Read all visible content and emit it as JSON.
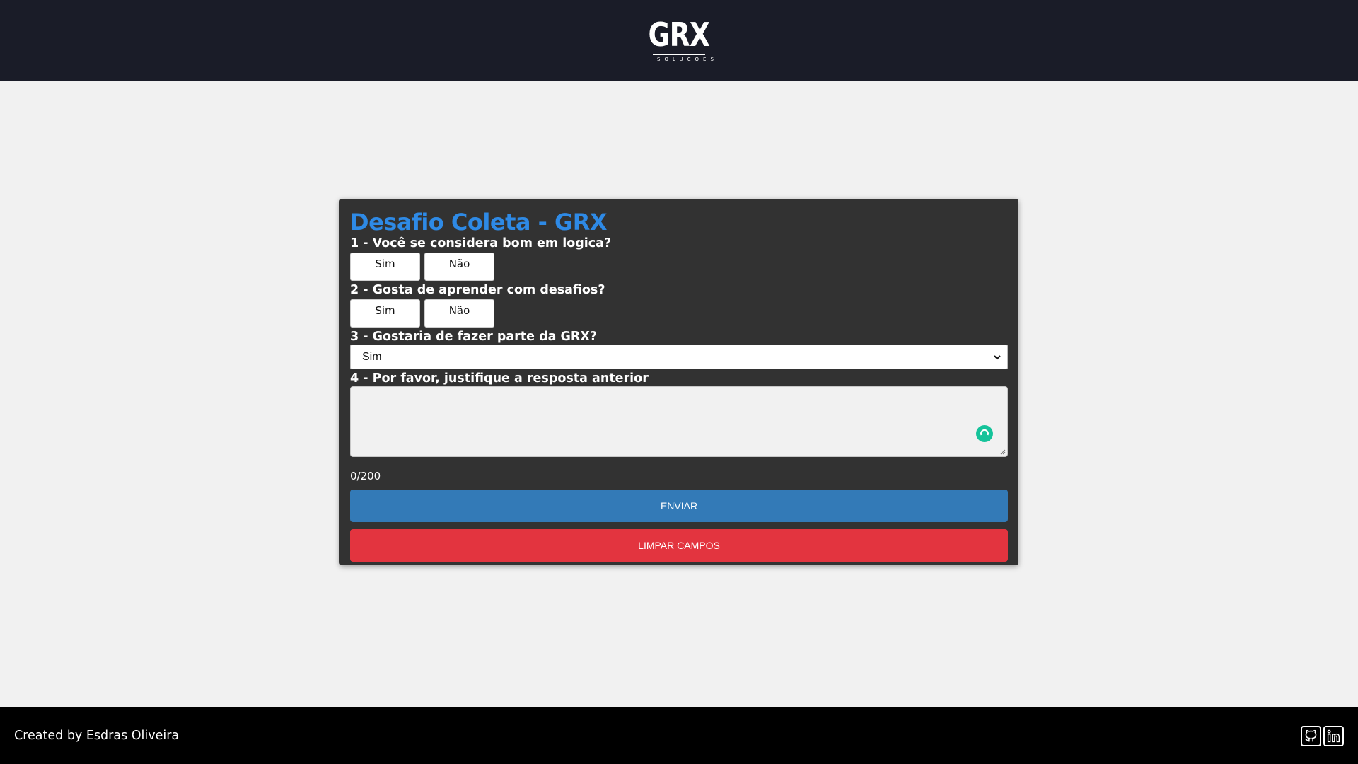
{
  "header": {
    "logo_main": "GRX",
    "logo_sub": "SOLUCOES"
  },
  "form": {
    "title": "Desafio Coleta - GRX",
    "q1": {
      "label": "1 - Você se considera bom em logica?",
      "options": [
        "Sim",
        "Não"
      ]
    },
    "q2": {
      "label": "2 - Gosta de aprender com desafios?",
      "options": [
        "Sim",
        "Não"
      ]
    },
    "q3": {
      "label": "3 - Gostaria de fazer parte da GRX?",
      "selected": "Sim"
    },
    "q4": {
      "label": "4 - Por favor, justifique a resposta anterior",
      "value": ""
    },
    "counter": "0/200",
    "send_label": "ENVIAR",
    "clear_label": "LIMPAR CAMPOS"
  },
  "footer": {
    "credit": "Created by Esdras Oliveira",
    "icons": [
      "github-icon",
      "linkedin-icon"
    ]
  },
  "colors": {
    "header_bg": "#1a1c28",
    "card_bg": "#323232",
    "title": "#2e8ae6",
    "send": "#337ab7",
    "clear": "#e3343f",
    "grammar": "#15c39a"
  }
}
